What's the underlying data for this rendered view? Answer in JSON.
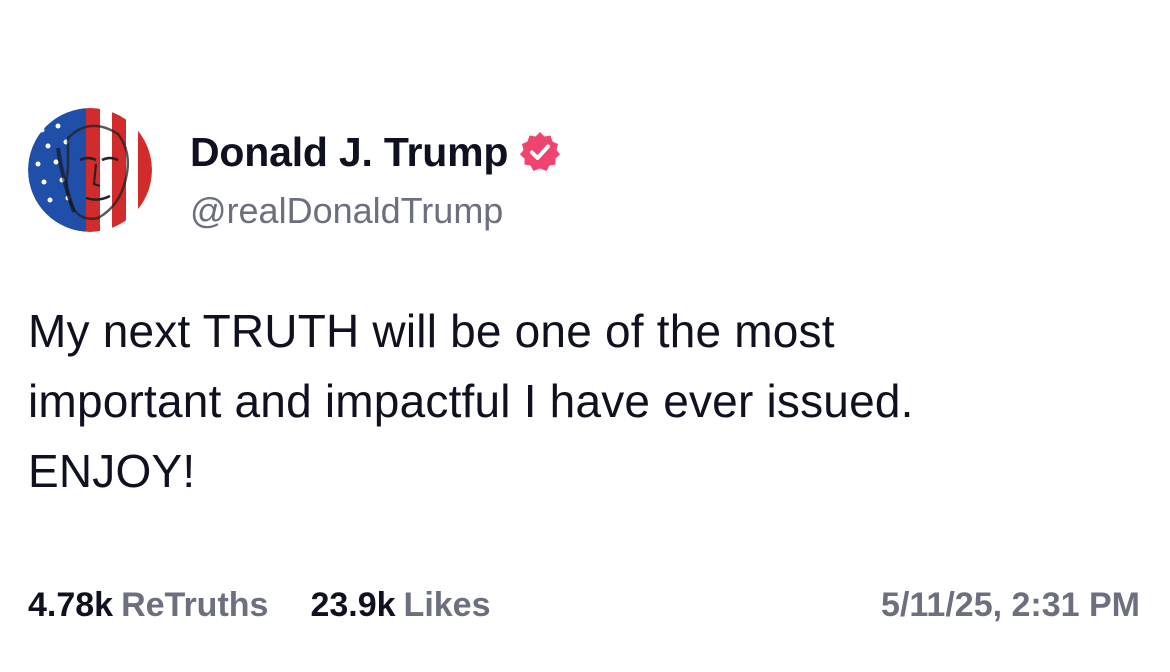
{
  "author": {
    "display_name": "Donald J. Trump",
    "handle": "@realDonaldTrump",
    "verified_icon": "verified-badge-icon",
    "verified_color": "#f0436e",
    "avatar_icon": "avatar-image"
  },
  "post": {
    "lines": [
      "My next TRUTH will be one of the most",
      "important and impactful I have ever issued.",
      "ENJOY!"
    ]
  },
  "stats": {
    "retruths_count": "4.78k",
    "retruths_label": "ReTruths",
    "likes_count": "23.9k",
    "likes_label": "Likes"
  },
  "timestamp": "5/11/25, 2:31 PM",
  "colors": {
    "text": "#0f1020",
    "muted": "#6b6f7e",
    "background": "#ffffff"
  }
}
